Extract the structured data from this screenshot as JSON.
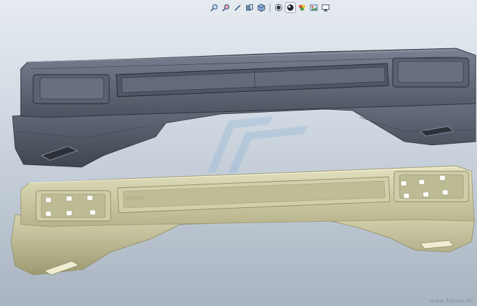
{
  "toolbar": {
    "buttons": [
      {
        "name": "zoom-to-fit-icon"
      },
      {
        "name": "zoom-area-icon"
      },
      {
        "name": "previous-view-icon"
      },
      {
        "name": "section-view-icon"
      },
      {
        "name": "view-orientation-icon"
      },
      {
        "name": "display-style-icon"
      },
      {
        "name": "hide-show-items-icon"
      },
      {
        "name": "edit-appearance-icon"
      },
      {
        "name": "apply-scene-icon"
      },
      {
        "name": "view-settings-icon"
      }
    ]
  },
  "viewport": {
    "background_top": "#e6ebf1",
    "background_bottom": "#a9b4c1",
    "upper_model_color": "#5c6472",
    "lower_model_color": "#c9c7a2",
    "watermark": "www.3dmax.3d"
  }
}
